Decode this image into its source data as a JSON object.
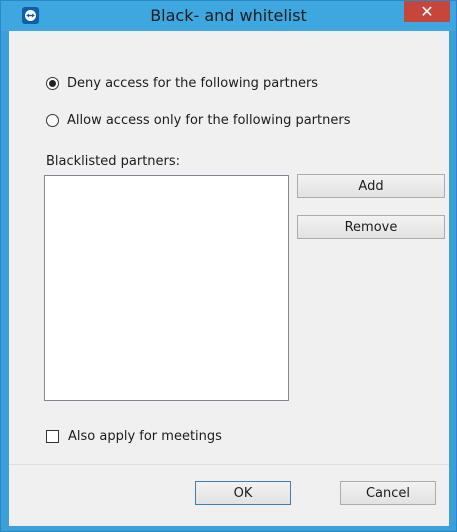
{
  "window": {
    "title": "Black- and whitelist",
    "close_glyph": "✕"
  },
  "options": {
    "deny_label": "Deny access for the following partners",
    "deny_checked": true,
    "allow_label": "Allow access only for the following partners",
    "allow_checked": false
  },
  "list": {
    "label": "Blacklisted partners:",
    "items": []
  },
  "buttons": {
    "add": "Add",
    "remove": "Remove",
    "ok": "OK",
    "cancel": "Cancel"
  },
  "meetings": {
    "label": "Also apply for meetings",
    "checked": false
  },
  "icons": {
    "app": "teamviewer-icon",
    "close": "close-icon"
  },
  "colors": {
    "titlebar": "#3ea7e0",
    "close_button": "#c7463b",
    "client": "#f0f0f0"
  }
}
